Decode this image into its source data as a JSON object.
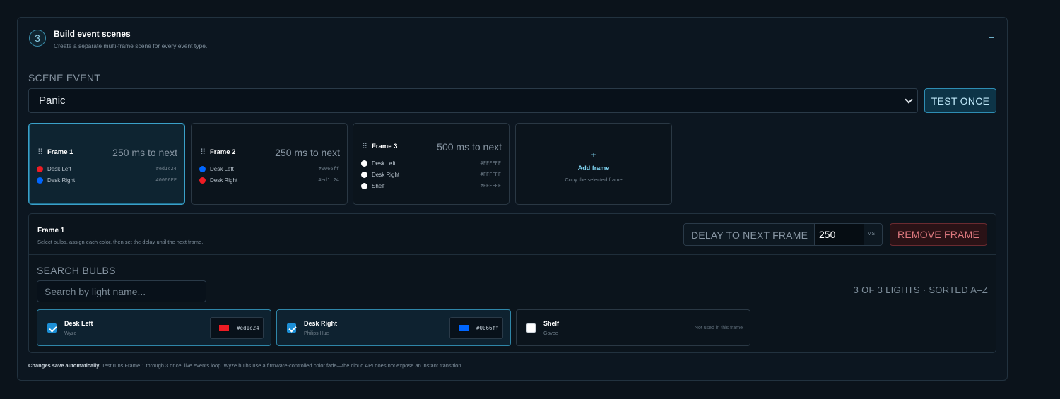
{
  "panel": {
    "step": "3",
    "title": "Build event scenes",
    "subtitle": "Create a separate multi-frame scene for every event type.",
    "collapse_glyph": "–"
  },
  "scene": {
    "label": "SCENE EVENT",
    "selected": "Panic",
    "test_button": "TEST ONCE"
  },
  "frames": [
    {
      "name": "Frame 1",
      "delay": "250 ms to next",
      "selected": true,
      "bulbs": [
        {
          "name": "Desk Left",
          "hex": "#ed1c24",
          "color": "#ed1c24"
        },
        {
          "name": "Desk Right",
          "hex": "#0066FF",
          "color": "#0066ff"
        }
      ]
    },
    {
      "name": "Frame 2",
      "delay": "250 ms to next",
      "selected": false,
      "bulbs": [
        {
          "name": "Desk Left",
          "hex": "#0066ff",
          "color": "#0066ff"
        },
        {
          "name": "Desk Right",
          "hex": "#ed1c24",
          "color": "#ed1c24"
        }
      ]
    },
    {
      "name": "Frame 3",
      "delay": "500 ms to next",
      "selected": false,
      "bulbs": [
        {
          "name": "Desk Left",
          "hex": "#FFFFFF",
          "color": "#ffffff"
        },
        {
          "name": "Desk Right",
          "hex": "#FFFFFF",
          "color": "#ffffff"
        },
        {
          "name": "Shelf",
          "hex": "#FFFFFF",
          "color": "#ffffff"
        }
      ]
    }
  ],
  "add_frame": {
    "plus": "+",
    "label": "Add frame",
    "sub": "Copy the selected frame"
  },
  "editor": {
    "title": "Frame 1",
    "subtitle": "Select bulbs, assign each color, then set the delay until the next frame.",
    "delay_label": "DELAY TO NEXT FRAME",
    "delay_value": "250",
    "delay_unit": "MS",
    "remove_button": "REMOVE FRAME",
    "search_label": "SEARCH BULBS",
    "search_placeholder": "Search by light name...",
    "count": "3 OF 3 LIGHTS · SORTED A–Z",
    "bulbs": [
      {
        "name": "Desk Left",
        "brand": "Wyze",
        "checked": true,
        "hex": "#ed1c24",
        "color": "#ed1c24"
      },
      {
        "name": "Desk Right",
        "brand": "Philips Hue",
        "checked": true,
        "hex": "#0066ff",
        "color": "#0066ff"
      },
      {
        "name": "Shelf",
        "brand": "Govee",
        "checked": false,
        "note": "Not used in this frame"
      }
    ]
  },
  "footer": {
    "bold": "Changes save automatically.",
    "text": " Test runs Frame 1 through 3 once; live events loop. Wyze bulbs use a firmware-controlled color fade—the cloud API does not expose an instant transition."
  },
  "icons": {
    "drag": "drag-handle-icon",
    "chevron": "chevron-down-icon",
    "check": "checkbox-icon",
    "plus": "plus-icon"
  }
}
